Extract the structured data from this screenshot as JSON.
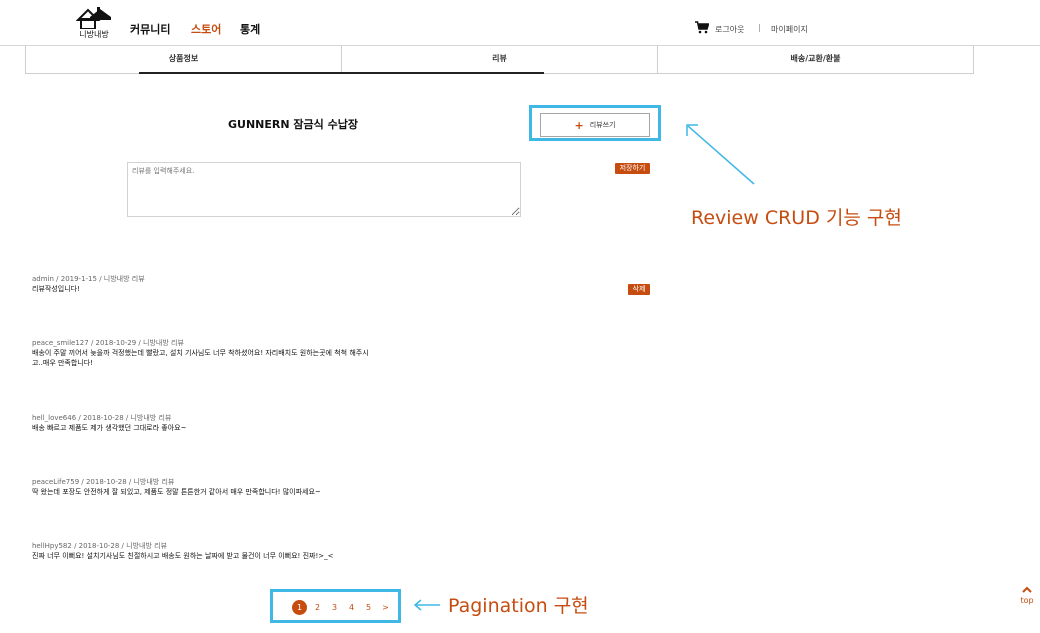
{
  "header": {
    "logo_text": "니방내방",
    "nav": [
      "커뮤니티",
      "스토어",
      "통계"
    ],
    "active_nav": "스토어",
    "logout_label": "로그아웃",
    "separator": "|",
    "mypage_label": "마이페이지"
  },
  "tabs": [
    {
      "label": "상품정보"
    },
    {
      "label": "리뷰"
    },
    {
      "label": "배송/교환/환불"
    }
  ],
  "product": {
    "title": "GUNNERN 잠금식 수납장"
  },
  "review_form": {
    "write_label": "리뷰쓰기",
    "placeholder": "리뷰를 입력해주세요.",
    "save_label": "저장하기"
  },
  "reviews": [
    {
      "meta": "admin / 2019-1-15 / 니방내방 리뷰",
      "body": "리뷰작성입니다!",
      "delete_label": "삭제"
    },
    {
      "meta": "peace_smile127 / 2018-10-29 / 니방내방 리뷰",
      "body": "배송이 주말 끼어서 늦을까 걱정했는데 빨랐고, 설치 기사님도 너무 착하셨어요! 자리배치도 원하는곳에 척척 해주시고..매우 만족합니다!"
    },
    {
      "meta": "hell_love646 / 2018-10-28 / 니방내방 리뷰",
      "body": "배송 빠르고 제품도 제가 생각했던 그대로라 좋아요~"
    },
    {
      "meta": "peaceLife759 / 2018-10-28 / 니방내방 리뷰",
      "body": "딱 왔는데 포장도 안전하게 잘 되있고, 제품도 정말 튼튼한거 같아서 매우 만족합니다! 많이파세요~"
    },
    {
      "meta": "hellHpy582 / 2018-10-28 / 니방내방 리뷰",
      "body": "진짜 너무 이뻐요! 설치기사님도 친절하시고 배송도 원하는 날짜에 받고 물건이 너무 이뻐요! 진짜!>_<"
    }
  ],
  "pagination": {
    "pages": [
      "1",
      "2",
      "3",
      "4",
      "5"
    ],
    "current": "1",
    "next_label": ">"
  },
  "annotations": {
    "crud": "Review CRUD 기능 구현",
    "pagination": "Pagination 구현"
  },
  "top_button": {
    "label": "top"
  },
  "colors": {
    "accent": "#c64c10",
    "highlight": "#3fb8e6"
  },
  "icons": {
    "cart": "shopping-cart-icon",
    "logo": "house-logo-icon",
    "top": "chevron-up-icon"
  }
}
